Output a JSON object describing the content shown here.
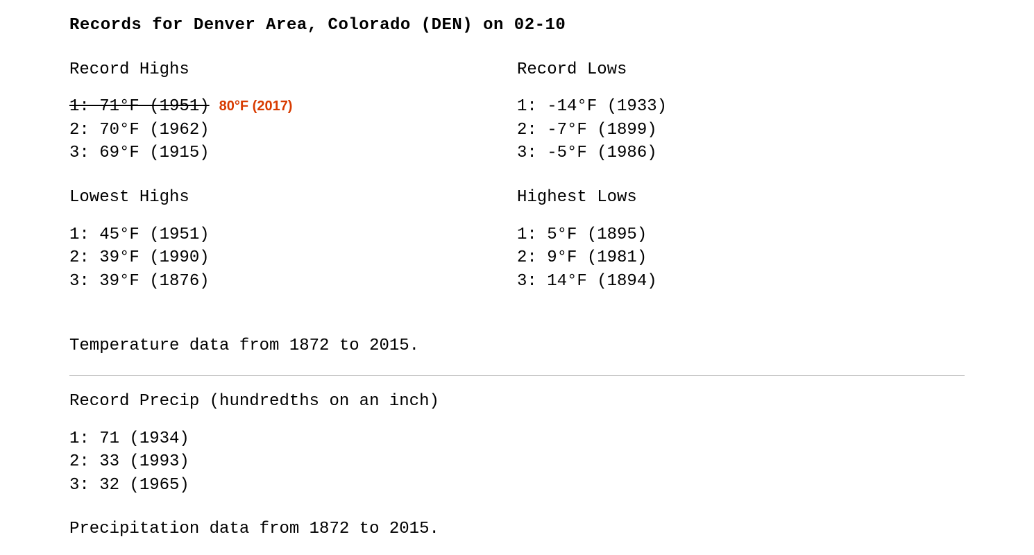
{
  "title": "Records for Denver Area, Colorado (DEN) on 02-10",
  "record_highs": {
    "heading": "Record Highs",
    "r1_struck": "1: 71°F (1951)",
    "r1_annotation": "80°F (2017)",
    "r2": "2: 70°F (1962)",
    "r3": "3: 69°F (1915)"
  },
  "record_lows": {
    "heading": "Record Lows",
    "r1": "1: -14°F (1933)",
    "r2": "2: -7°F (1899)",
    "r3": "3: -5°F (1986)"
  },
  "lowest_highs": {
    "heading": "Lowest Highs",
    "r1": "1: 45°F (1951)",
    "r2": "2: 39°F (1990)",
    "r3": "3: 39°F (1876)"
  },
  "highest_lows": {
    "heading": "Highest Lows",
    "r1": "1: 5°F (1895)",
    "r2": "2: 9°F (1981)",
    "r3": "3: 14°F (1894)"
  },
  "temp_footnote": "Temperature data from 1872 to 2015.",
  "precip": {
    "heading": "Record Precip (hundredths on an inch)",
    "r1": "1: 71 (1934)",
    "r2": "2: 33 (1993)",
    "r3": "3: 32 (1965)"
  },
  "precip_footnote": "Precipitation data from 1872 to 2015."
}
